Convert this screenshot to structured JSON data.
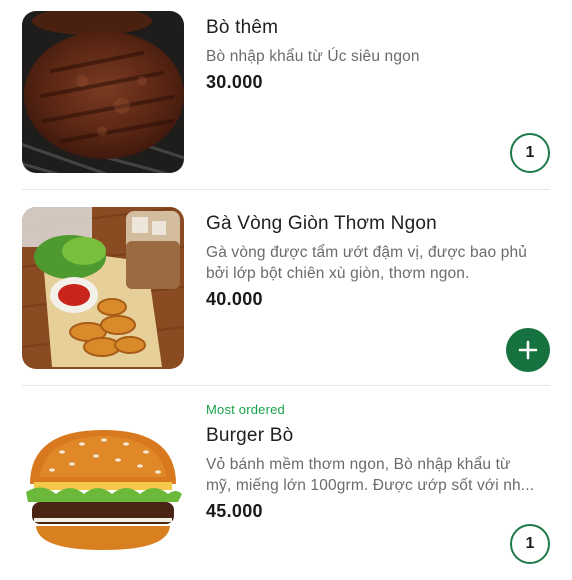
{
  "items": [
    {
      "title": "Bò thêm",
      "description": "Bò nhập khẩu từ Úc siêu ngon",
      "price": "30.000",
      "quantity": "1",
      "image": "beef-patty-image"
    },
    {
      "title": "Gà Vòng Giòn Thơm Ngon",
      "description": "Gà vòng được tẩm ướt đậm vị, được bao phủ bởi lớp bột chiên xù giòn, thơm ngon.",
      "price": "40.000",
      "action": "add",
      "image": "chicken-rings-image"
    },
    {
      "badge": "Most ordered",
      "title": "Burger Bò",
      "description_line1": "Vỏ bánh mềm thơm ngon, Bò nhập khẩu từ",
      "description_line2": "mỹ, miếng lớn 100grm. Được ướp sốt với nh...",
      "price": "45.000",
      "quantity": "1",
      "image": "beef-burger-image"
    }
  ],
  "colors": {
    "accent": "#16733f",
    "badge": "#1aa24a",
    "description": "#6b6b6b"
  },
  "icons": {
    "add": "plus-icon"
  }
}
